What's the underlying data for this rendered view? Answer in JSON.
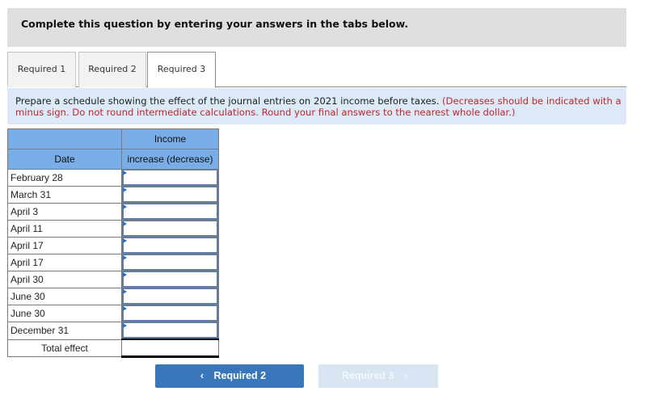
{
  "banner": {
    "text": "Complete this question by entering your answers in the tabs below."
  },
  "tabs": [
    {
      "label": "Required 1",
      "active": false
    },
    {
      "label": "Required 2",
      "active": false
    },
    {
      "label": "Required 3",
      "active": true
    }
  ],
  "instructions": {
    "text": "Prepare a schedule showing the effect of the journal entries on 2021 income before taxes.",
    "note": "(Decreases should be indicated with a minus sign. Do not round intermediate calculations. Round your final answers to the nearest whole dollar.)"
  },
  "table": {
    "headers": {
      "date": "Date",
      "income_top": "Income",
      "income_bottom": "increase (decrease)"
    },
    "rows": [
      {
        "date": "February 28",
        "value": ""
      },
      {
        "date": "March 31",
        "value": ""
      },
      {
        "date": "April 3",
        "value": ""
      },
      {
        "date": "April 11",
        "value": ""
      },
      {
        "date": "April 17",
        "value": ""
      },
      {
        "date": "April 17",
        "value": ""
      },
      {
        "date": "April 30",
        "value": ""
      },
      {
        "date": "June 30",
        "value": ""
      },
      {
        "date": "June 30",
        "value": ""
      },
      {
        "date": "December 31",
        "value": ""
      }
    ],
    "total_label": "Total effect",
    "total_value": ""
  },
  "navigation": {
    "prev_label": "Required 2",
    "prev_icon": "chevron-left-icon",
    "next_label": "Required 3",
    "next_icon": "chevron-right-icon",
    "next_disabled": true
  },
  "colors": {
    "header_blue": "#78aee5",
    "instruction_bg": "#dbeaf6",
    "note_red": "#c0262d",
    "button_blue": "#3a76ba",
    "button_disabled": "#d8e4f2"
  }
}
